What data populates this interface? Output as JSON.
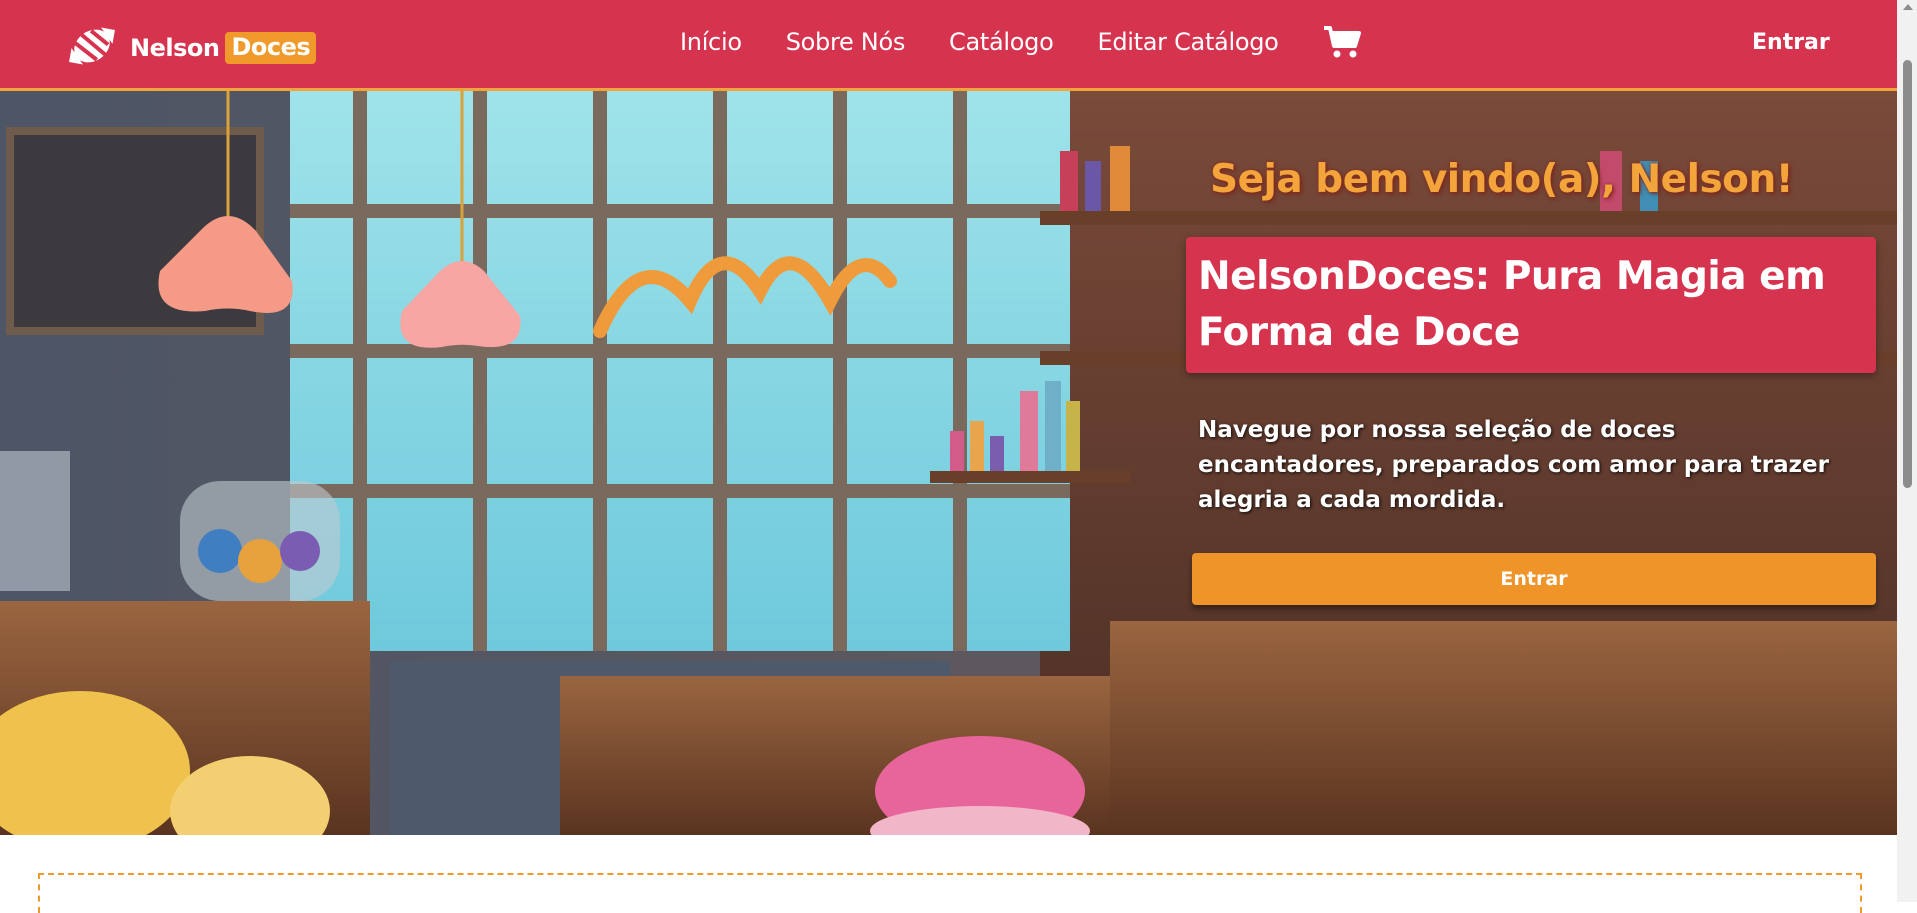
{
  "brand": {
    "name": "Nelson",
    "tag": "Doces",
    "icon": "candy-icon"
  },
  "nav": {
    "links": [
      "Início",
      "Sobre Nós",
      "Catálogo",
      "Editar Catálogo"
    ],
    "cart_icon": "cart-icon",
    "login_label": "Entrar"
  },
  "hero": {
    "welcome": "Seja bem vindo(a), Nelson!",
    "headline": "NelsonDoces: Pura Magia em Forma de Doce",
    "subtext": "Navegue por nossa seleção de doces encantadores, preparados com amor para trazer alegria a cada mordida.",
    "button_label": "Entrar"
  },
  "colors": {
    "primary": "#d6334f",
    "accent": "#f19a2c",
    "white": "#ffffff"
  }
}
